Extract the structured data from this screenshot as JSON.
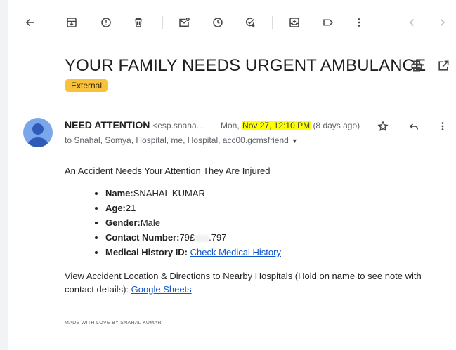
{
  "toolbar": {
    "icons": [
      "back-arrow-icon",
      "archive-icon",
      "report-spam-icon",
      "delete-icon",
      "mark-unread-icon",
      "snooze-icon",
      "add-task-icon",
      "move-to-icon",
      "label-icon",
      "more-vert-icon",
      "chevron-left-icon",
      "chevron-right-icon"
    ]
  },
  "email": {
    "subject": "YOUR FAMILY NEEDS URGENT AMBULANCE",
    "badge": "External",
    "sender_name": "NEED ATTENTION",
    "sender_email": "<esp.snaha...",
    "date_prefix": "Mon,",
    "date_highlight": "Nov 27, 12:10 PM",
    "date_suffix": "(8 days ago)",
    "recipients": "to Snahal, Somya, Hospital, me, Hospital, acc00.gcmsfriend",
    "body": {
      "intro": "An Accident Needs Your Attention They Are Injured",
      "name_label": "Name:",
      "name_value": "SNAHAL KUMAR",
      "age_label": "Age:",
      "age_value": "21",
      "gender_label": "Gender:",
      "gender_value": "Male",
      "contact_label": "Contact Number:",
      "contact_start": "79£",
      "contact_end": ".797",
      "history_label": "Medical History ID:",
      "history_link": "Check Medical History",
      "location_text": "View Accident Location & Directions to Nearby Hospitals (Hold on name to see note with contact details):",
      "location_link": "Google Sheets"
    },
    "footer": "MADE WITH LOVE BY SNAHAL KUMAR"
  },
  "colors": {
    "badge": "#f9c23c",
    "highlight": "#ffff00",
    "link": "#1155cc",
    "avatar": "#7aa7ec"
  }
}
